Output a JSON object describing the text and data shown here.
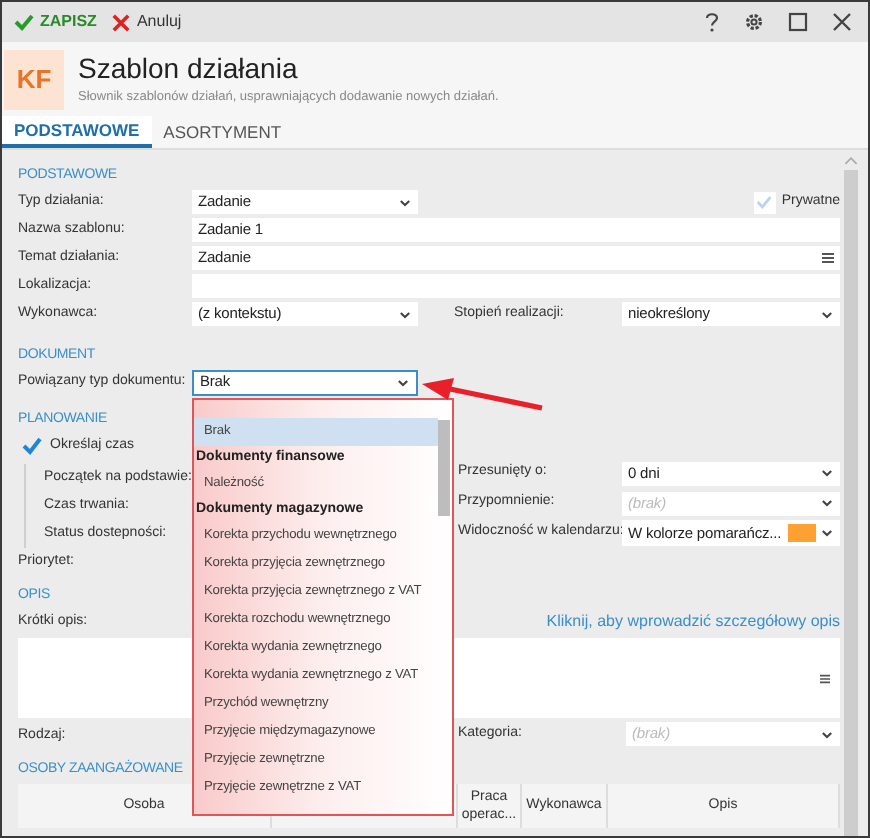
{
  "toolbar": {
    "actions": [
      {
        "label": "ZAPISZ",
        "kind": "save"
      },
      {
        "label": "Anuluj",
        "kind": "cancel"
      }
    ]
  },
  "header": {
    "logo": "KF",
    "title": "Szablon działania",
    "subtitle": "Słownik szablonów działań, usprawniających dodawanie nowych działań."
  },
  "tabs": [
    {
      "label": "PODSTAWOWE",
      "selected": true
    },
    {
      "label": "ASORTYMENT",
      "selected": false
    }
  ],
  "basic": {
    "heading": "PODSTAWOWE",
    "type": {
      "label": "Typ działania:",
      "value": "Zadanie"
    },
    "private": {
      "label": "Prywatne",
      "checked": true
    },
    "name": {
      "label": "Nazwa szablonu:",
      "value": "Zadanie 1"
    },
    "subject": {
      "label": "Temat działania:",
      "value": "Zadanie"
    },
    "location": {
      "label": "Lokalizacja:"
    },
    "performer": {
      "label": "Wykonawca:",
      "value": "(z kontekstu)"
    },
    "progress": {
      "label": "Stopień realizacji:",
      "value": "nieokreślony"
    }
  },
  "document": {
    "heading": "DOKUMENT",
    "doc_type": {
      "label": "Powiązany typ dokumentu:",
      "value": "Brak",
      "expanded": true
    },
    "options": [
      {
        "kind": "option",
        "label": "Brak",
        "selected": true
      },
      {
        "kind": "group",
        "label": "Dokumenty finansowe"
      },
      {
        "kind": "option",
        "label": "Należność",
        "selected": false
      },
      {
        "kind": "group",
        "label": "Dokumenty magazynowe"
      },
      {
        "kind": "option",
        "label": "Korekta przychodu wewnętrznego",
        "selected": false
      },
      {
        "kind": "option",
        "label": "Korekta przyjęcia zewnętrznego",
        "selected": false
      },
      {
        "kind": "option",
        "label": "Korekta przyjęcia zewnętrznego z VAT",
        "selected": false
      },
      {
        "kind": "option",
        "label": "Korekta rozchodu wewnętrznego",
        "selected": false
      },
      {
        "kind": "option",
        "label": "Korekta wydania zewnętrznego",
        "selected": false
      },
      {
        "kind": "option",
        "label": "Korekta wydania zewnętrznego z VAT",
        "selected": false
      },
      {
        "kind": "option",
        "label": "Przychód wewnętrzny",
        "selected": false
      },
      {
        "kind": "option",
        "label": "Przyjęcie międzymagazynowe",
        "selected": false
      },
      {
        "kind": "option",
        "label": "Przyjęcie zewnętrzne",
        "selected": false
      },
      {
        "kind": "option",
        "label": "Przyjęcie zewnętrzne z VAT",
        "selected": false
      }
    ]
  },
  "planning": {
    "heading": "PLANOWANIE",
    "specify_time": {
      "label": "Określaj czas",
      "checked": true
    },
    "sub_labels": [
      "Początek na podstawie:",
      "Czas trwania:",
      "Status dostepności:"
    ],
    "priority_label": "Priorytet:",
    "shift": {
      "label": "Przesunięty o:",
      "value": "0 dni"
    },
    "reminder": {
      "label": "Przypomnienie:",
      "placeholder": "(brak)"
    },
    "visibility": {
      "label": "Widoczność w kalendarzu:",
      "value": "W kolorze pomarańcz...",
      "color": "#ffa033"
    }
  },
  "description": {
    "heading": "OPIS",
    "short_label": "Krótki opis:",
    "detail_link": "Kliknij, aby wprowadzić szczegółowy opis",
    "kind_label": "Rodzaj:",
    "category": {
      "label": "Kategoria:",
      "placeholder": "(brak)"
    }
  },
  "people": {
    "heading": "OSOBY ZAANGAŻOWANE",
    "columns": [
      "Osoba",
      "Praca operac...",
      "Wykonawca",
      "Opis"
    ]
  }
}
